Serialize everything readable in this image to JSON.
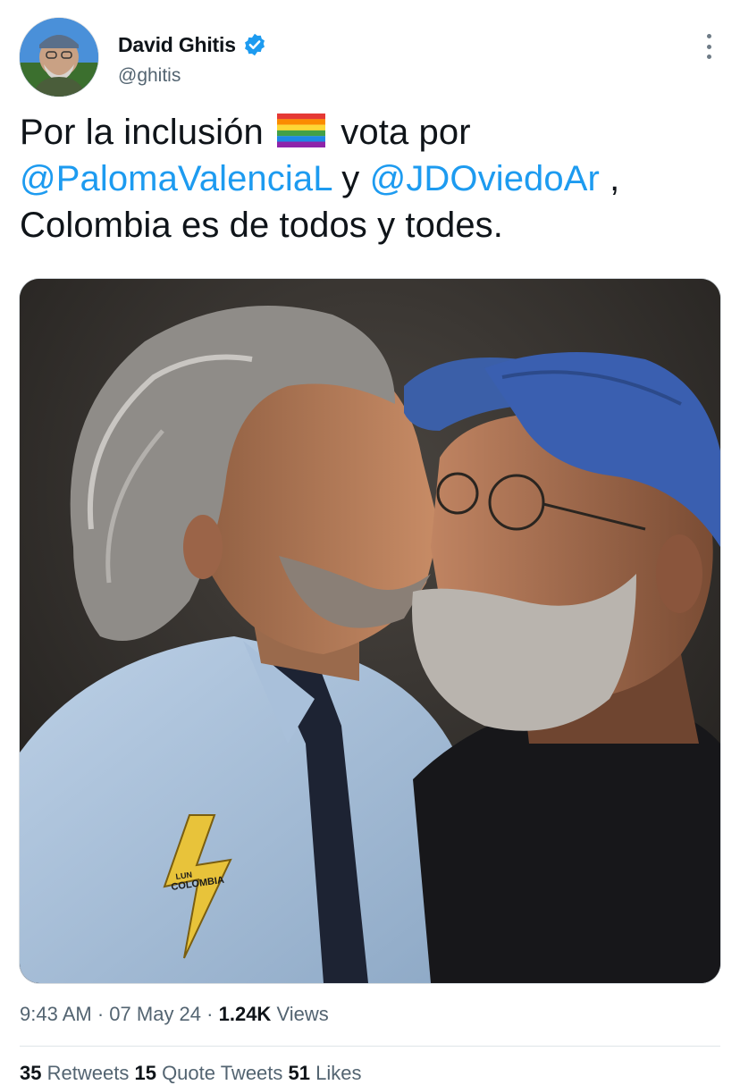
{
  "author": {
    "name": "David Ghitis",
    "handle": "@ghitis",
    "verified_icon": "verified-badge-icon",
    "accent": "#1d9bf0"
  },
  "tweet": {
    "text_part1": "Por la inclusión",
    "emoji": "rainbow-flag-icon",
    "text_part2": "vota por",
    "mention1": "@PalomaValenciaL",
    "connector": "y",
    "mention2": "@JDOviedoAr",
    "comma": ",",
    "text_part3": "Colombia es de todos y todes.",
    "image_pin_text_small": "LUN",
    "image_pin_text": "COLOMBIA"
  },
  "meta": {
    "time": "9:43 AM",
    "separator": "·",
    "date": "07 May 24",
    "views_count": "1.24K",
    "views_label": "Views"
  },
  "stats": {
    "retweets_count": "35",
    "retweets_label": "Retweets",
    "quotes_count": "15",
    "quotes_label": "Quote Tweets",
    "likes_count": "51",
    "likes_label": "Likes"
  },
  "colors": {
    "text": "#0f1419",
    "secondary": "#536471",
    "link": "#1d9bf0"
  }
}
